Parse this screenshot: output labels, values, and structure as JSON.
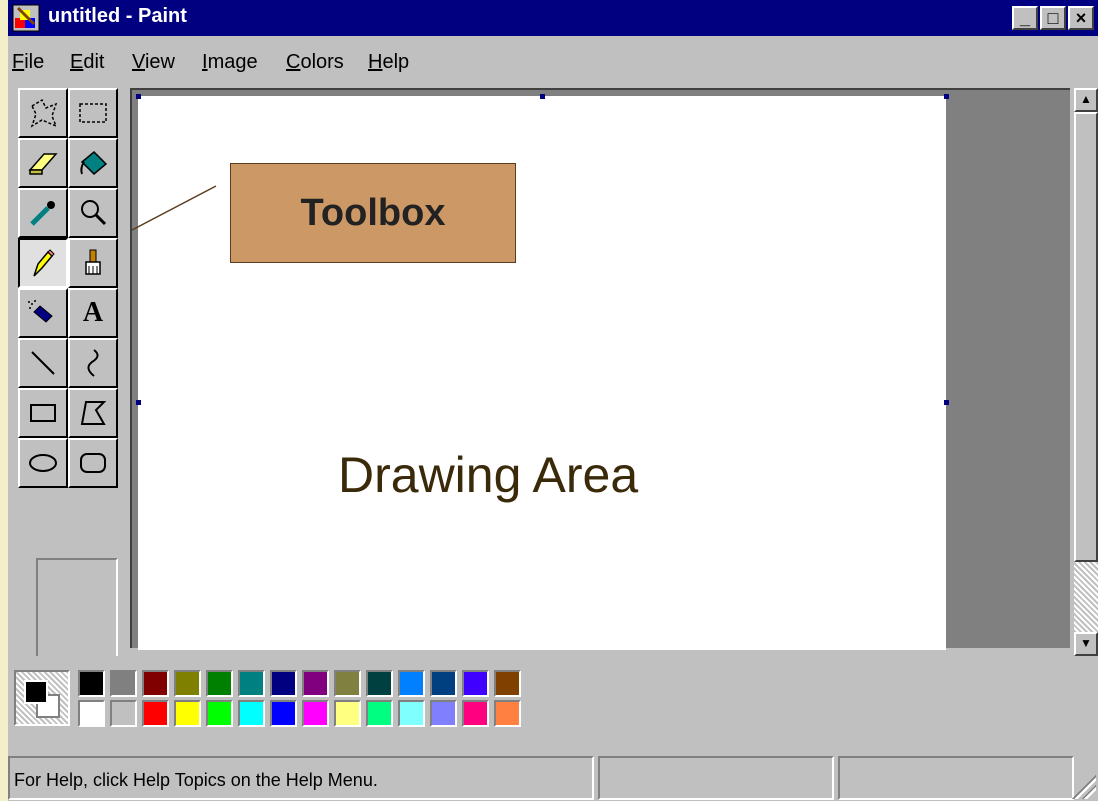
{
  "window": {
    "title": "untitled - Paint",
    "controls": {
      "minimize": "_",
      "maximize": "□",
      "close": "×"
    }
  },
  "menu": [
    {
      "label": "File",
      "mnemonic": "F",
      "rest": "ile"
    },
    {
      "label": "Edit",
      "mnemonic": "E",
      "rest": "dit"
    },
    {
      "label": "View",
      "mnemonic": "V",
      "rest": "iew"
    },
    {
      "label": "Image",
      "mnemonic": "I",
      "rest": "mage"
    },
    {
      "label": "Colors",
      "mnemonic": "C",
      "rest": "olors"
    },
    {
      "label": "Help",
      "mnemonic": "H",
      "rest": "elp"
    }
  ],
  "tools": [
    {
      "name": "free-form-select",
      "icon": "free-select-icon"
    },
    {
      "name": "select",
      "icon": "rect-select-icon"
    },
    {
      "name": "eraser",
      "icon": "eraser-icon"
    },
    {
      "name": "fill",
      "icon": "fill-bucket-icon"
    },
    {
      "name": "pick-color",
      "icon": "eyedropper-icon"
    },
    {
      "name": "magnifier",
      "icon": "magnifier-icon"
    },
    {
      "name": "pencil",
      "icon": "pencil-icon",
      "selected": true
    },
    {
      "name": "brush",
      "icon": "brush-icon"
    },
    {
      "name": "airbrush",
      "icon": "airbrush-icon"
    },
    {
      "name": "text",
      "icon": "text-icon",
      "glyph": "A"
    },
    {
      "name": "line",
      "icon": "line-icon"
    },
    {
      "name": "curve",
      "icon": "curve-icon"
    },
    {
      "name": "rectangle",
      "icon": "rectangle-icon"
    },
    {
      "name": "polygon",
      "icon": "polygon-icon"
    },
    {
      "name": "ellipse",
      "icon": "ellipse-icon"
    },
    {
      "name": "rounded-rectangle",
      "icon": "rounded-rectangle-icon"
    }
  ],
  "annotations": {
    "toolbox_label": "Toolbox",
    "drawing_area_label": "Drawing Area"
  },
  "palette": {
    "foreground": "#000000",
    "background": "#ffffff",
    "row1": [
      "#000000",
      "#808080",
      "#800000",
      "#808000",
      "#008000",
      "#008080",
      "#000080",
      "#800080",
      "#808040",
      "#004040",
      "#0080ff",
      "#004080",
      "#4000ff",
      "#804000"
    ],
    "row2": [
      "#ffffff",
      "#c0c0c0",
      "#ff0000",
      "#ffff00",
      "#00ff00",
      "#00ffff",
      "#0000ff",
      "#ff00ff",
      "#ffff80",
      "#00ff80",
      "#80ffff",
      "#8080ff",
      "#ff0080",
      "#ff8040"
    ]
  },
  "status": {
    "help_text": "For Help, click Help Topics on the Help Menu."
  },
  "colors": {
    "title_bar": "#000080",
    "face": "#c0c0c0",
    "callout_fill": "#cc9966"
  }
}
